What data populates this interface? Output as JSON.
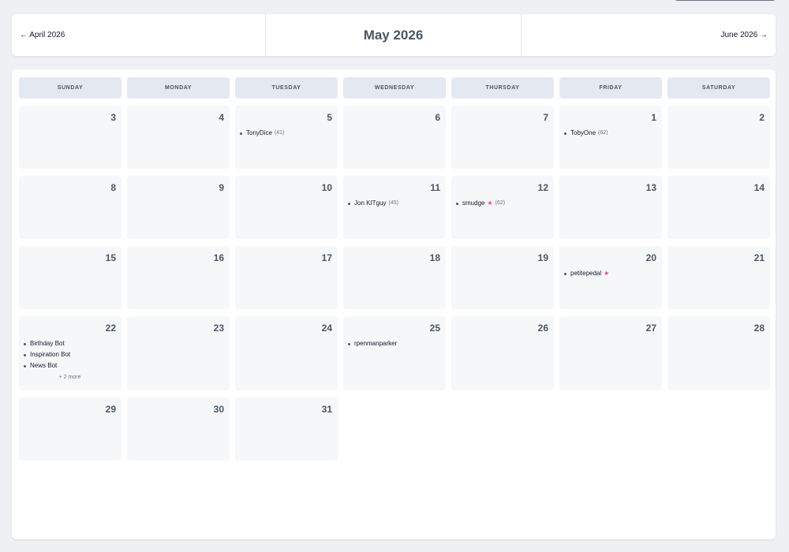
{
  "nav": {
    "prev": "← April 2026",
    "title": "May 2026",
    "next": "June 2026 →"
  },
  "weekdays": [
    "SUNDAY",
    "MONDAY",
    "TUESDAY",
    "WEDNESDAY",
    "THURSDAY",
    "FRIDAY",
    "SATURDAY"
  ],
  "days": {
    "d1": "1",
    "d2": "2",
    "d3": "3",
    "d4": "4",
    "d5": "5",
    "d6": "6",
    "d7": "7",
    "d8": "8",
    "d9": "9",
    "d10": "10",
    "d11": "11",
    "d12": "12",
    "d13": "13",
    "d14": "14",
    "d15": "15",
    "d16": "16",
    "d17": "17",
    "d18": "18",
    "d19": "19",
    "d20": "20",
    "d21": "21",
    "d22": "22",
    "d23": "23",
    "d24": "24",
    "d25": "25",
    "d26": "26",
    "d27": "27",
    "d28": "28",
    "d29": "29",
    "d30": "30",
    "d31": "31"
  },
  "events": {
    "d1": [
      {
        "name": "TobyOne",
        "count": "(62)"
      }
    ],
    "d5": [
      {
        "name": "TonyDice",
        "count": "(41)"
      }
    ],
    "d11": [
      {
        "name": "Jon KITguy",
        "count": "(45)"
      }
    ],
    "d12": [
      {
        "name": "smudge",
        "star": "★",
        "count": "(62)"
      }
    ],
    "d20": [
      {
        "name": "petitepedal",
        "star": "★"
      }
    ],
    "d22": [
      {
        "name": "Birthday Bot"
      },
      {
        "name": "Inspiration Bot"
      },
      {
        "name": "News Bot"
      }
    ],
    "d22_more": "+ 2 more",
    "d25": [
      {
        "name": "rpenmanparker"
      }
    ]
  },
  "colors": {
    "accent_star": "#ec4899",
    "header_bg": "#e4e8f0",
    "cell_bg": "#f6f7f9"
  }
}
